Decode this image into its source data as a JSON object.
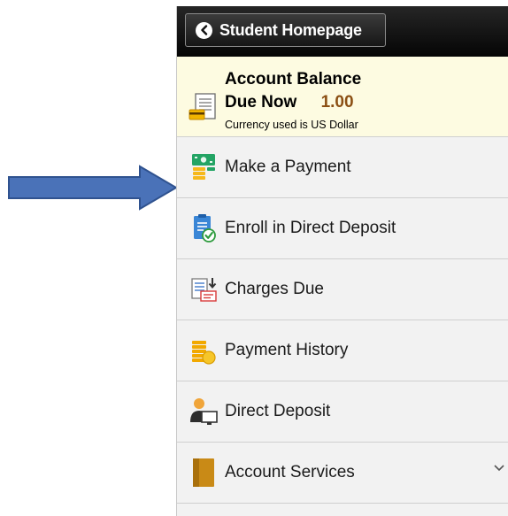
{
  "header": {
    "back_label": "Student Homepage"
  },
  "balance": {
    "title": "Account Balance",
    "due_label": "Due Now",
    "due_amount": "1.00",
    "currency_note": "Currency used is US Dollar"
  },
  "menu": {
    "items": [
      {
        "label": "Make a Payment",
        "icon": "payment-icon"
      },
      {
        "label": "Enroll in Direct Deposit",
        "icon": "enroll-deposit-icon"
      },
      {
        "label": "Charges Due",
        "icon": "charges-icon"
      },
      {
        "label": "Payment History",
        "icon": "coins-icon"
      },
      {
        "label": "Direct Deposit",
        "icon": "direct-deposit-icon"
      },
      {
        "label": "Account Services",
        "icon": "folder-icon"
      }
    ]
  },
  "colors": {
    "amount": "#8b4f13",
    "arrow": "#4a72b8",
    "balance_bg": "#fdfbe1"
  }
}
